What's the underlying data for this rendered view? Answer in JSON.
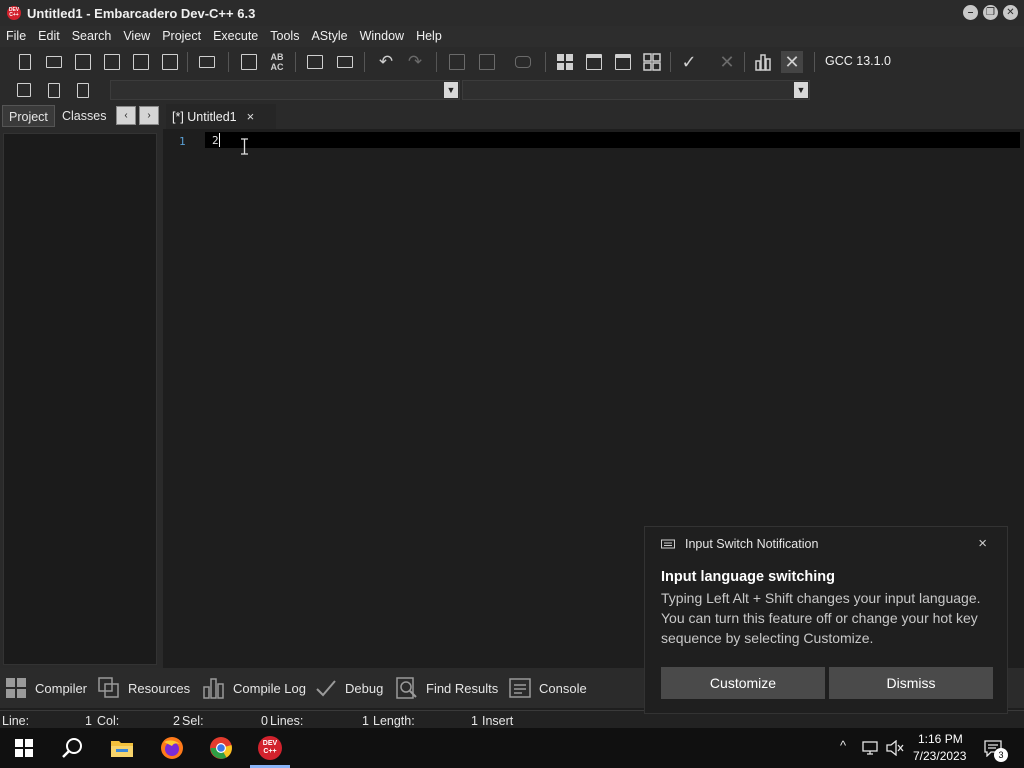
{
  "window": {
    "app_icon_text": "DEV C++",
    "title": "Untitled1 - Embarcadero Dev-C++ 6.3",
    "controls": [
      "minimize",
      "restore",
      "close"
    ]
  },
  "menu": [
    "File",
    "Edit",
    "Search",
    "View",
    "Project",
    "Execute",
    "Tools",
    "AStyle",
    "Window",
    "Help"
  ],
  "toolbar": {
    "compiler": "GCC 13.1.0",
    "icons": [
      "new-file-icon",
      "open-file-icon",
      "save-icon",
      "save-all-icon",
      "close-file-icon",
      "close-all-icon",
      "print-icon",
      "find-icon",
      "replace-icon",
      "goto-icon",
      "split-icon",
      "undo-icon",
      "redo-icon",
      "indent-icon",
      "unindent-icon",
      "comment-icon",
      "compile-icon",
      "run-icon",
      "compile-run-icon",
      "rebuild-icon",
      "syntax-check-icon",
      "stop-icon",
      "chart-icon",
      "debug-stop-icon"
    ],
    "row2_icons": [
      "project-options-icon",
      "bookmark-icon",
      "goto-bookmark-icon"
    ]
  },
  "left_panel": {
    "tabs": [
      "Project",
      "Classes"
    ],
    "prev": "‹",
    "next": "›"
  },
  "editor": {
    "tab_label": "[*] Untitled1",
    "tab_close": "×",
    "line_number": "1",
    "code": "2"
  },
  "bottom_tabs": [
    {
      "label": "Compiler",
      "icon": "grid-icon"
    },
    {
      "label": "Resources",
      "icon": "resources-icon"
    },
    {
      "label": "Compile Log",
      "icon": "bar-chart-icon"
    },
    {
      "label": "Debug",
      "icon": "check-icon"
    },
    {
      "label": "Find Results",
      "icon": "search-doc-icon"
    },
    {
      "label": "Console",
      "icon": "console-icon"
    }
  ],
  "status": {
    "line_label": "Line:",
    "line_value": "1",
    "col_label": "Col:",
    "col_value": "2",
    "sel_label": "Sel:",
    "sel_value": "0",
    "lines_label": "Lines:",
    "lines_value": "1",
    "length_label": "Length:",
    "length_value": "1",
    "mode": "Insert"
  },
  "notification": {
    "app": "Input Switch Notification",
    "title": "Input language switching",
    "body": "Typing Left Alt + Shift changes your input language. You can turn this feature off or change your hot key sequence by selecting Customize.",
    "close": "×",
    "buttons": [
      "Customize",
      "Dismiss"
    ]
  },
  "taskbar": {
    "apps": [
      "start-icon",
      "search-icon",
      "file-explorer-icon",
      "firefox-icon",
      "chrome-icon",
      "devcpp-icon"
    ],
    "devcpp_icon_text": "DEV C++",
    "time": "1:16 PM",
    "date": "7/23/2023",
    "notification_count": "3",
    "tray_chevron": "^"
  },
  "colors": {
    "background": "#1e1e1e",
    "toolbar": "#2a2a2a",
    "accent": "#8ab4f8",
    "app_icon": "#d2222d",
    "line_number": "#5a9fd4"
  }
}
